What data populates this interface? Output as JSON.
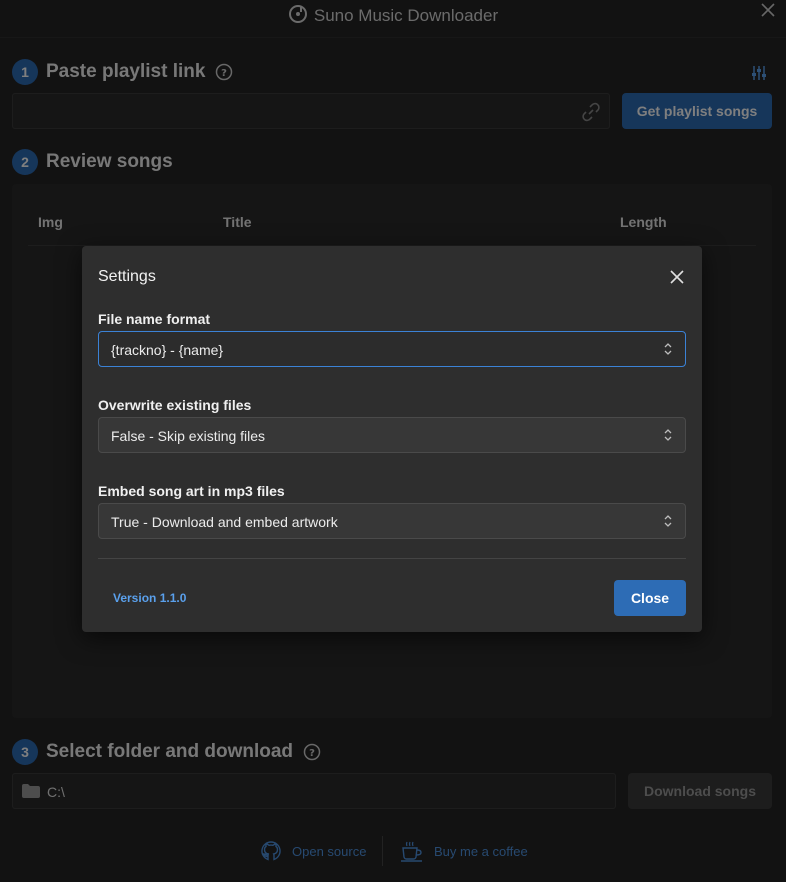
{
  "app": {
    "title": "Suno Music Downloader"
  },
  "step1": {
    "number": "1",
    "label": "Paste playlist link",
    "url_value": "",
    "url_placeholder": "",
    "get_button": "Get playlist songs"
  },
  "step2": {
    "number": "2",
    "label": "Review songs",
    "columns": [
      "Img",
      "Title",
      "Length"
    ]
  },
  "step3": {
    "number": "3",
    "label": "Select folder and download",
    "folder": "C:\\",
    "download_button": "Download songs"
  },
  "footer": {
    "open_source": "Open source",
    "coffee": "Buy me a coffee"
  },
  "settings": {
    "title": "Settings",
    "fields": [
      {
        "label": "File name format",
        "value": "{trackno} - {name}"
      },
      {
        "label": "Overwrite existing files",
        "value": "False - Skip existing files"
      },
      {
        "label": "Embed song art in mp3 files",
        "value": "True - Download and embed artwork"
      }
    ],
    "version": "Version 1.1.0",
    "close_button": "Close"
  },
  "colors": {
    "accent": "#2d6cb5",
    "link": "#4e93e0",
    "background": "#242424",
    "modal": "#2e2e2e"
  },
  "icons": [
    "app-logo-icon",
    "window-close-icon",
    "help-icon",
    "settings-sliders-icon",
    "link-icon",
    "folder-icon",
    "github-icon",
    "coffee-icon",
    "close-icon",
    "chevron-updown-icon"
  ]
}
